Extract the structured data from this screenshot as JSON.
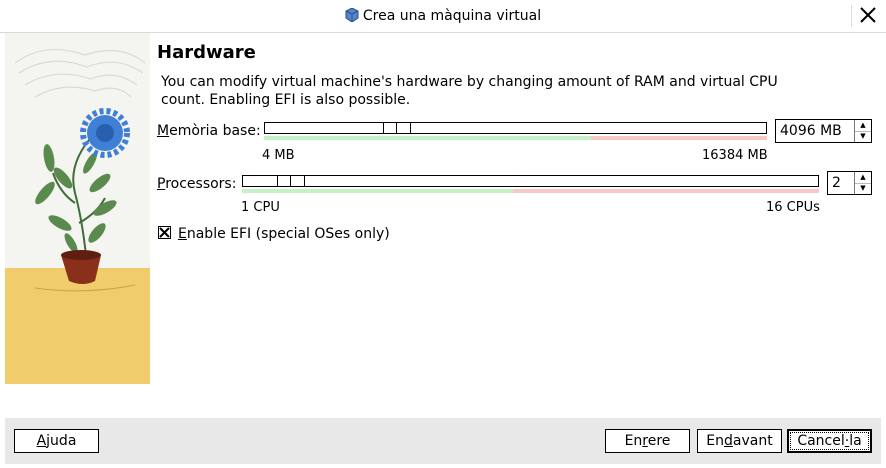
{
  "window": {
    "title": "Crea una màquina virtual"
  },
  "page": {
    "heading": "Hardware",
    "description": "You can modify virtual machine's hardware by changing amount of RAM and virtual CPU count. Enabling EFI is also possible."
  },
  "memory": {
    "label_mnemonic": "M",
    "label_rest": "emòria base:",
    "min_label": "4 MB",
    "max_label": "16384 MB",
    "value": "4096 MB",
    "level_fraction": 0.25
  },
  "processors": {
    "label_mnemonic": "P",
    "label_rest": "rocessors:",
    "min_label": "1 CPU",
    "max_label": "16 CPUs",
    "value": "2",
    "level_fraction": 0.0625
  },
  "efi": {
    "checked": true,
    "label_mnemonic": "E",
    "label_rest": "nable EFI (special OSes only)"
  },
  "buttons": {
    "help": {
      "mnemonic": "A",
      "rest": "juda"
    },
    "back": {
      "pre": "En",
      "mnemonic": "r",
      "rest": "ere"
    },
    "next": {
      "pre": "En",
      "mnemonic": "d",
      "rest": "avant"
    },
    "cancel": {
      "pre": "Cancel",
      "mnemonic": "·",
      "rest": "la"
    }
  },
  "colors": {
    "safe_zone": "#c6f0c6",
    "danger_zone": "#f6c8c8",
    "sidebar_sky": "#f2f2ee",
    "sidebar_floor": "#f1cc6d",
    "flower": "#3f7fd6",
    "pot": "#8a2f1a"
  }
}
